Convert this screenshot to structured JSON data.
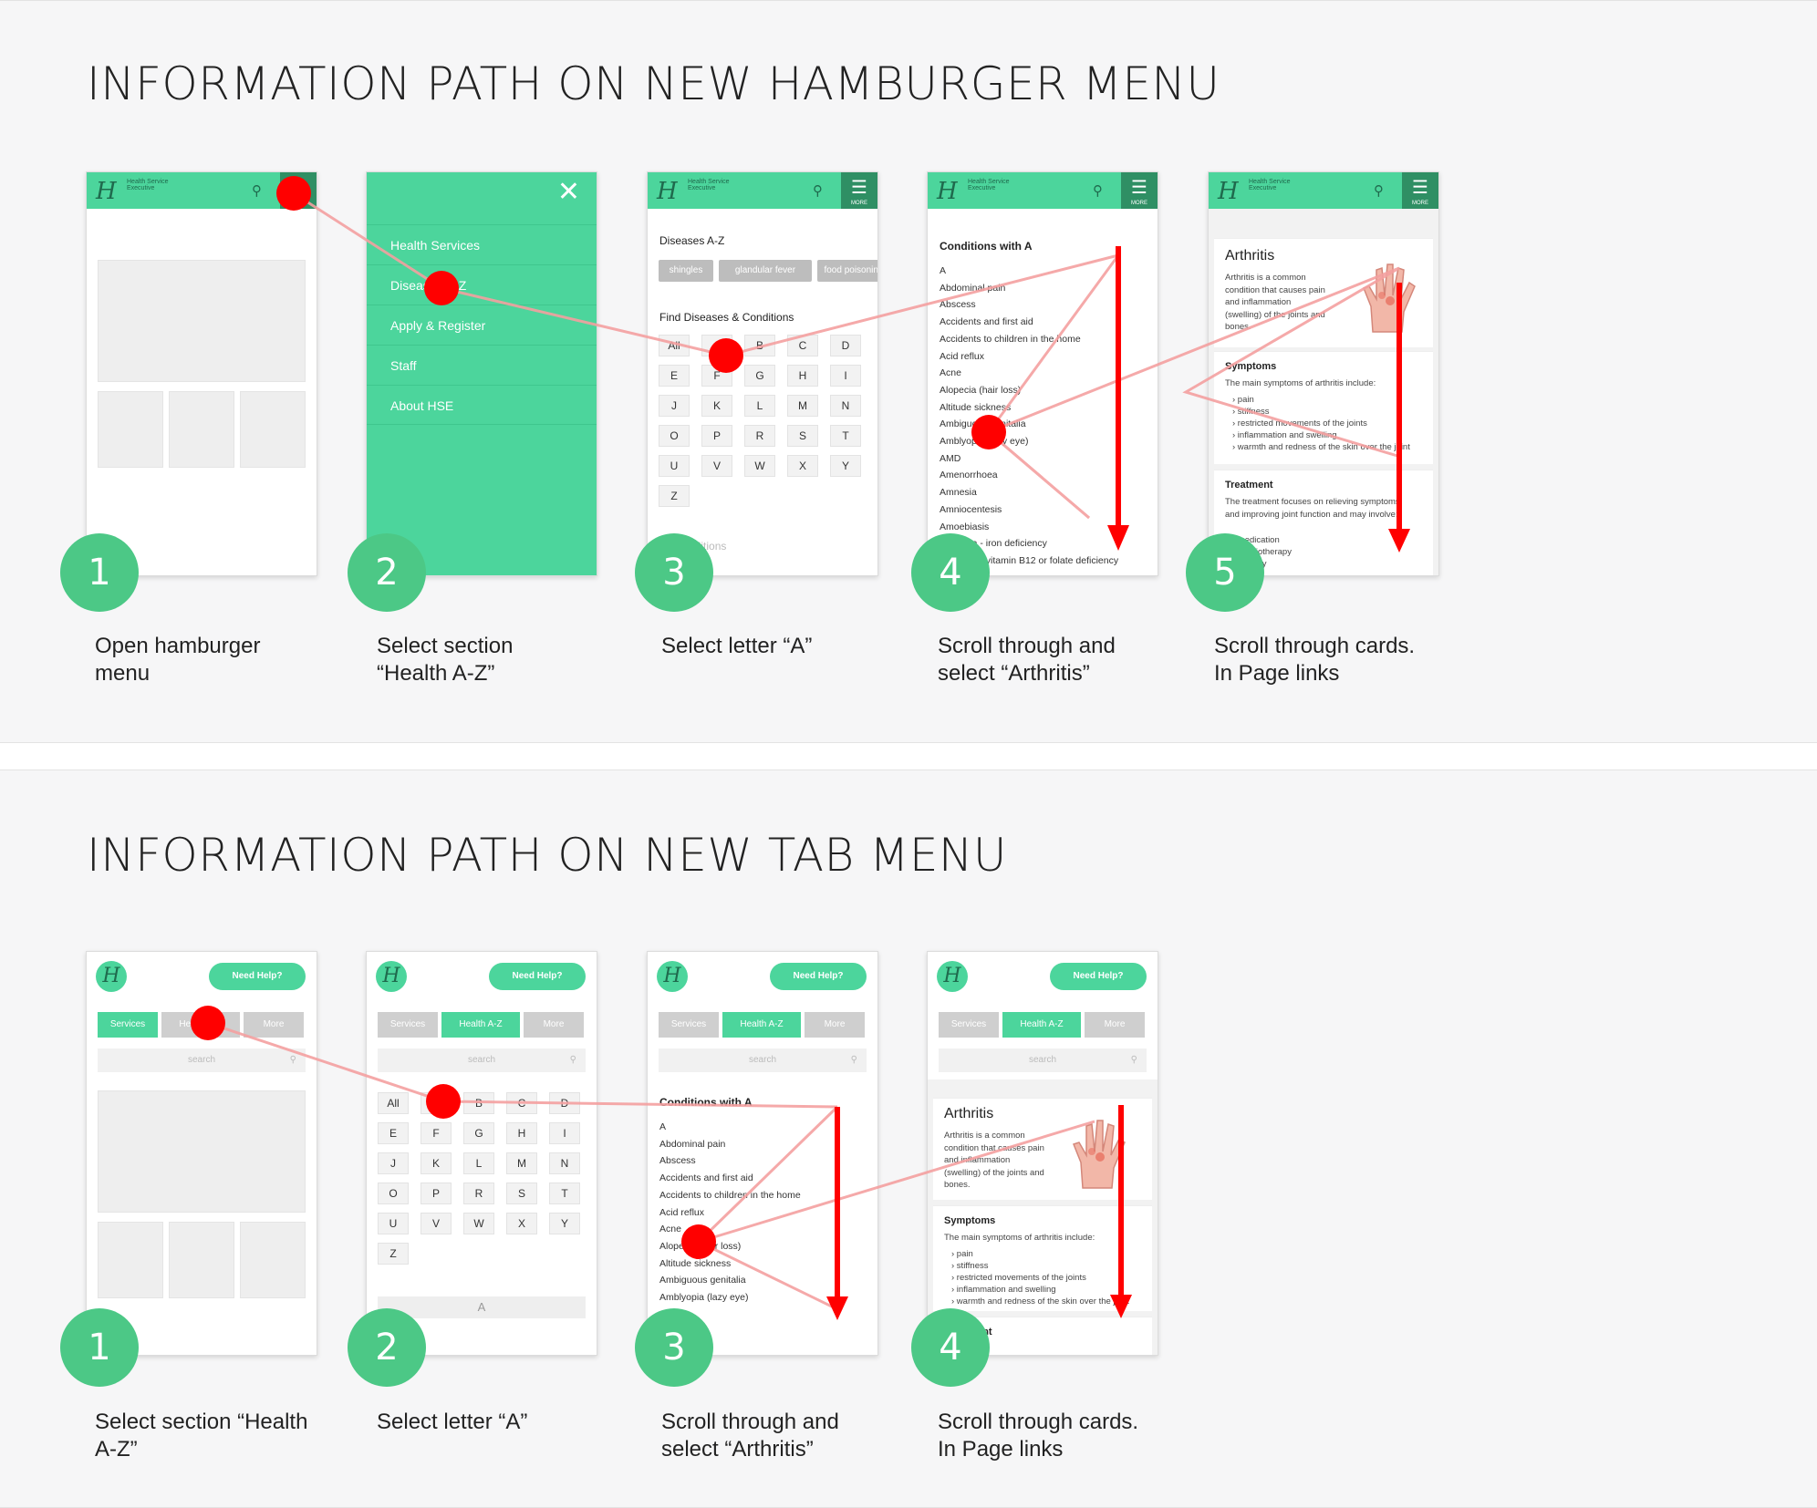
{
  "sections": [
    {
      "title": "INFORMATION PATH ON NEW HAMBURGER MENU"
    },
    {
      "title": "INFORMATION PATH ON NEW TAB MENU"
    }
  ],
  "brand": {
    "logo_text": "Health Service Executive",
    "menu_label": "MORE",
    "accent": "#4cd59c",
    "accent_dark": "#2f8f64",
    "marker": "#ff0000",
    "step_green": "#4cc886"
  },
  "hamburger_menu": {
    "items": [
      "Health Services",
      "Diseases A-Z",
      "Apply & Register",
      "Staff",
      "About HSE"
    ]
  },
  "diseases_screen": {
    "title": "Diseases A-Z",
    "chips": [
      "shingles",
      "glandular fever",
      "food poisoning"
    ],
    "find_title": "Find Diseases & Conditions",
    "letters": [
      "All",
      "A",
      "B",
      "C",
      "D",
      "E",
      "F",
      "G",
      "H",
      "I",
      "J",
      "K",
      "L",
      "M",
      "N",
      "O",
      "P",
      "R",
      "S",
      "T",
      "U",
      "V",
      "W",
      "X",
      "Y",
      "Z"
    ],
    "all_conditions": "All Conditions"
  },
  "conditions_screen": {
    "title": "Conditions with A",
    "items": [
      "A",
      "Abdominal pain",
      "Abscess",
      "Accidents and first aid",
      "Accidents to children in the home",
      "Acid reflux",
      "Acne",
      "Alopecia (hair loss)",
      "Altitude sickness",
      "Ambiguous genitalia",
      "Amblyopia (lazy eye)",
      "AMD",
      "Amenorrhoea",
      "Amnesia",
      "Amniocentesis",
      "Amoebiasis",
      "Anaemia - iron deficiency",
      "Anaemia - vitamin B12 or folate deficiency"
    ]
  },
  "arthritis_screen": {
    "title": "Arthritis",
    "intro": "Arthritis is a common condition that causes pain and inflammation (swelling) of the joints and bones.",
    "symptoms_title": "Symptoms",
    "symptoms_intro": "The main symptoms of arthritis include:",
    "symptoms": [
      "pain",
      "stiffness",
      "restricted movements of the joints",
      "inflammation and swelling",
      "warmth and redness of the skin over the joint"
    ],
    "treatment_title": "Treatment",
    "treatment_text": "The treatment focuses on relieving symptoms and improving joint function and may involve:",
    "treatments": [
      "medication",
      "physiotherapy",
      "surgery"
    ]
  },
  "tab_menu": {
    "need_help": "Need Help?",
    "tabs": [
      "Services",
      "Health A-Z",
      "More"
    ],
    "search_placeholder": "search",
    "letter_footer": "A"
  },
  "steps_hamburger": [
    {
      "number": "1",
      "caption": "Open hamburger menu"
    },
    {
      "number": "2",
      "caption": "Select section “Health A-Z”"
    },
    {
      "number": "3",
      "caption": "Select letter “A”"
    },
    {
      "number": "4",
      "caption": "Scroll through and select “Arthritis”"
    },
    {
      "number": "5",
      "caption": "Scroll through cards. In Page links"
    }
  ],
  "steps_tab": [
    {
      "number": "1",
      "caption": "Select section “Health A-Z”"
    },
    {
      "number": "2",
      "caption": "Select letter “A”"
    },
    {
      "number": "3",
      "caption": "Scroll through and select “Arthritis”"
    },
    {
      "number": "4",
      "caption": "Scroll through cards. In Page links"
    }
  ]
}
